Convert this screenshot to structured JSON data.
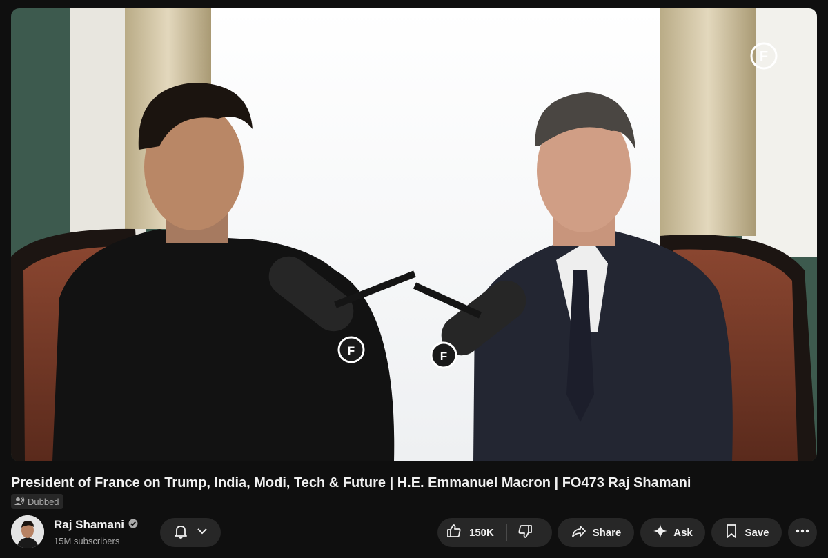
{
  "video": {
    "title": "President of France on Trump, India, Modi, Tech & Future | H.E. Emmanuel Macron | FO473 Raj Shamani",
    "badge_label": "Dubbed",
    "watermark_letter": "F"
  },
  "channel": {
    "name": "Raj Shamani",
    "subscribers": "15M subscribers",
    "verified_icon": "verified-check-icon"
  },
  "actions": {
    "like_count": "150K",
    "share_label": "Share",
    "ask_label": "Ask",
    "save_label": "Save"
  },
  "colors": {
    "background": "#0f0f0f",
    "pill": "#272727",
    "text": "#f1f1f1",
    "secondary_text": "#aaaaaa"
  }
}
